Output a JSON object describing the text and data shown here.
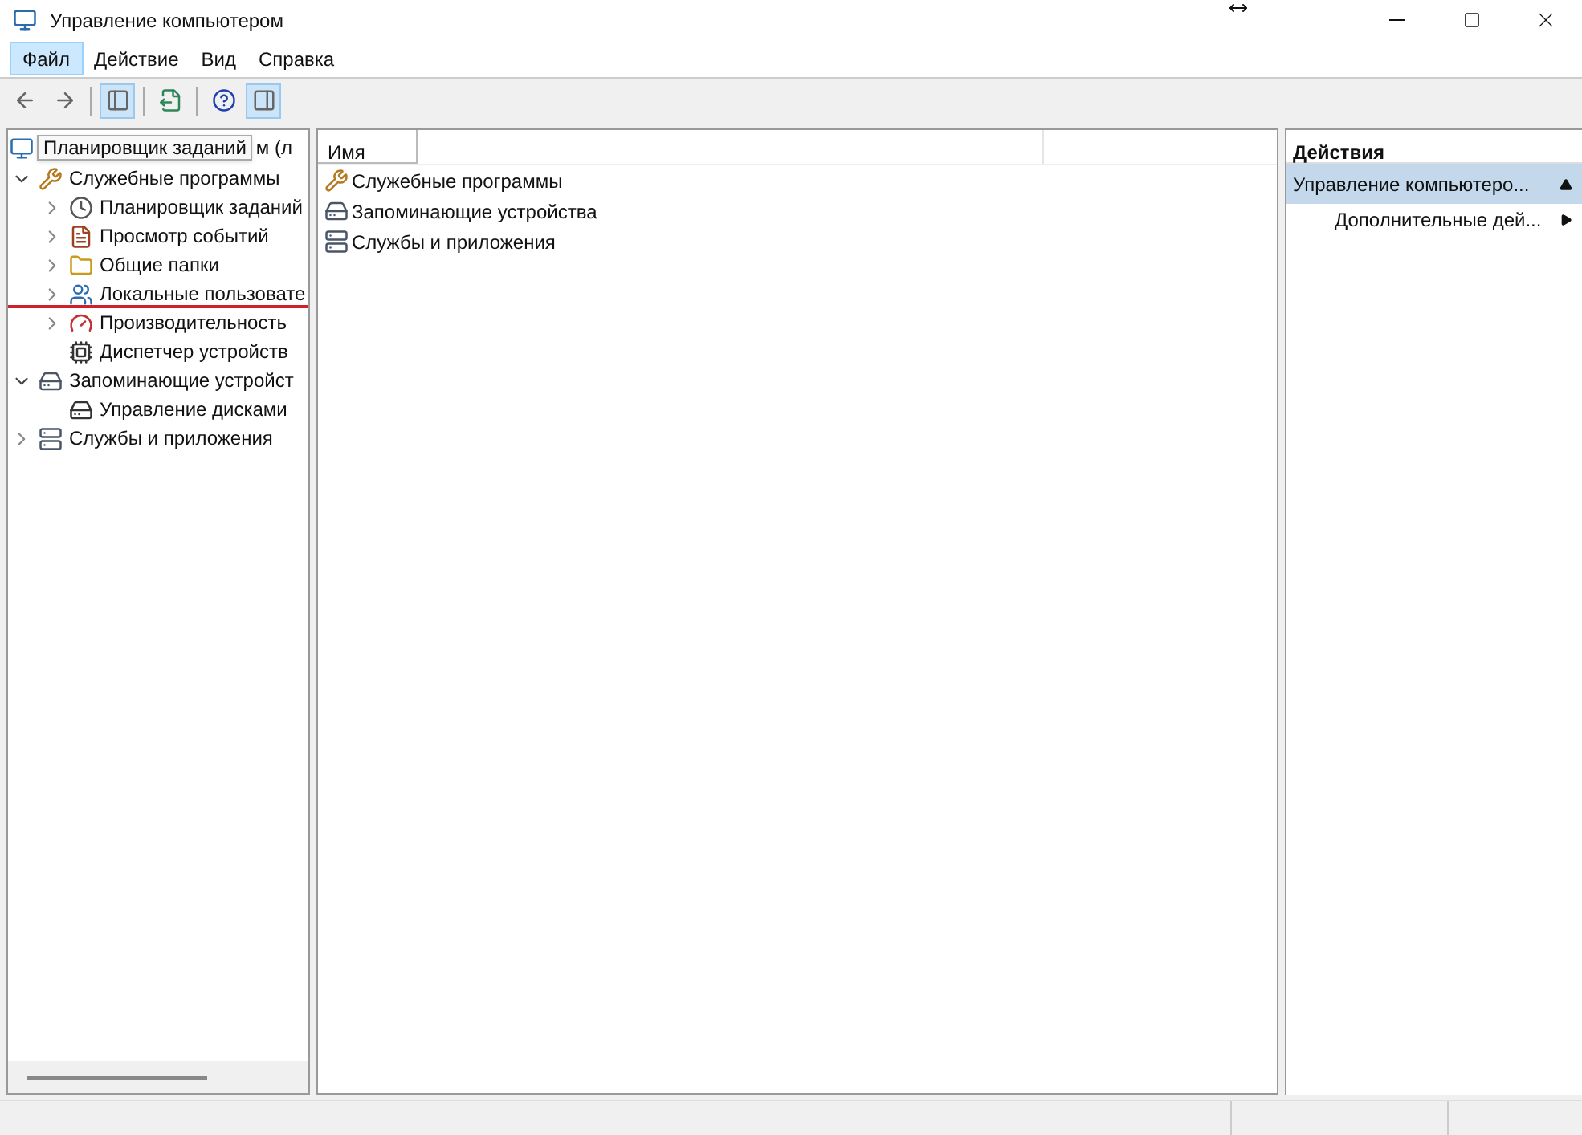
{
  "window": {
    "title": "Управление компьютером"
  },
  "menu": [
    {
      "label": "Файл",
      "selected": true
    },
    {
      "label": "Действие",
      "selected": false
    },
    {
      "label": "Вид",
      "selected": false
    },
    {
      "label": "Справка",
      "selected": false
    }
  ],
  "toolbar": [
    {
      "kind": "back",
      "pressed": false
    },
    {
      "kind": "forward",
      "pressed": false
    },
    {
      "kind": "sep"
    },
    {
      "kind": "tree",
      "pressed": true
    },
    {
      "kind": "sep"
    },
    {
      "kind": "export",
      "pressed": false
    },
    {
      "kind": "sep"
    },
    {
      "kind": "help",
      "pressed": false
    },
    {
      "kind": "actions",
      "pressed": true
    }
  ],
  "tree": {
    "label": "м (л",
    "kind": "computer",
    "tooltip": "Планировщик заданий",
    "children": [
      {
        "label": "Служебные программы",
        "kind": "tools",
        "expanded": true,
        "children": [
          {
            "label": "Планировщик заданий",
            "kind": "clock",
            "expanded": false
          },
          {
            "label": "Просмотр событий",
            "kind": "log",
            "expanded": false
          },
          {
            "label": "Общие папки",
            "kind": "folder",
            "expanded": false
          },
          {
            "label": "Локальные пользовате",
            "kind": "users",
            "expanded": false
          },
          {
            "label": "Производительность",
            "kind": "gauge",
            "expanded": false
          },
          {
            "label": "Диспетчер устройств",
            "kind": "device"
          }
        ]
      },
      {
        "label": "Запоминающие устройст",
        "kind": "storage",
        "expanded": true,
        "children": [
          {
            "label": "Управление дисками",
            "kind": "disk"
          }
        ]
      },
      {
        "label": "Службы и приложения",
        "kind": "services",
        "expanded": false
      }
    ]
  },
  "list": {
    "column": "Имя",
    "items": [
      {
        "label": "Служебные программы",
        "kind": "tools"
      },
      {
        "label": "Запоминающие устройства",
        "kind": "storage"
      },
      {
        "label": "Службы и приложения",
        "kind": "services"
      }
    ]
  },
  "actions": {
    "title": "Действия",
    "group": "Управление компьютеро...",
    "items": [
      "Дополнительные дей..."
    ]
  }
}
